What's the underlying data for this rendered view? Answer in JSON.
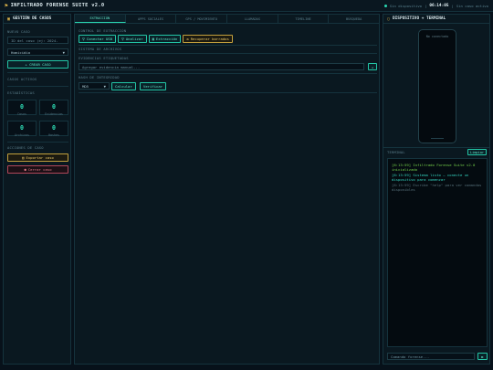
{
  "header": {
    "title": "INFILTRADO FORENSE SUITE v2.0",
    "status_devices": "Sin dispositivo",
    "clock": "06:14:05",
    "case_status": "Sin caso activo"
  },
  "sidebar": {
    "title": "GESTIÓN DE CASOS",
    "new_case_label": "NUEVO CASO",
    "case_id_placeholder": "ID del caso (ej: 2024-",
    "case_type": "Homicidio",
    "create_label": "+ CREAR CASO",
    "active_cases_label": "CASOS ACTIVOS",
    "stats_label": "ESTADÍSTICAS",
    "stats": [
      {
        "value": "0",
        "label": "Casos"
      },
      {
        "value": "0",
        "label": "Evidencias"
      },
      {
        "value": "0",
        "label": "Archivos"
      },
      {
        "value": "0",
        "label": "Hashes"
      }
    ],
    "actions_label": "ACCIONES DE CASO",
    "export_label": "Exportar caso",
    "close_label": "Cerrar caso"
  },
  "main": {
    "tabs": [
      "EXTRACCIÓN",
      "APPS SOCIALES",
      "GPS / MOVIMIENTO",
      "LLAMADAS",
      "TIMELINE",
      "BÚSQUEDA"
    ],
    "extraction_label": "CONTROL DE EXTRACCIÓN",
    "buttons": {
      "connect": "Conectar USB",
      "analyze": "Analizar",
      "extract": "Extracción",
      "recover": "Recuperar borrados"
    },
    "filesystem_label": "SISTEMA DE ARCHIVOS",
    "evidence_label": "EVIDENCIAS ETIQUETADAS",
    "evidence_placeholder": "Agregar evidencia manual...",
    "add_label": "+",
    "hash_label": "HASH DE INTEGRIDAD",
    "hash_algo": "MD5",
    "calc_label": "Calcular",
    "verify_label": "Verificar"
  },
  "right": {
    "title": "DISPOSITIVO + TERMINAL",
    "device_placeholder": "No conectado",
    "terminal_label": "TERMINAL",
    "clear_label": "Limpiar",
    "logs": [
      {
        "text": "[6:13:59] Infiltrado Forense Suite v2.0 inicializado",
        "color": "green"
      },
      {
        "text": "[6:13:59] Sistema listo – conecte un dispositivo para comenzar",
        "color": "teal"
      },
      {
        "text": "[6:13:59] Escribe \"help\" para ver comandos disponibles",
        "color": "grey"
      }
    ],
    "command_placeholder": "Comando forense...",
    "send_label": "▶"
  }
}
